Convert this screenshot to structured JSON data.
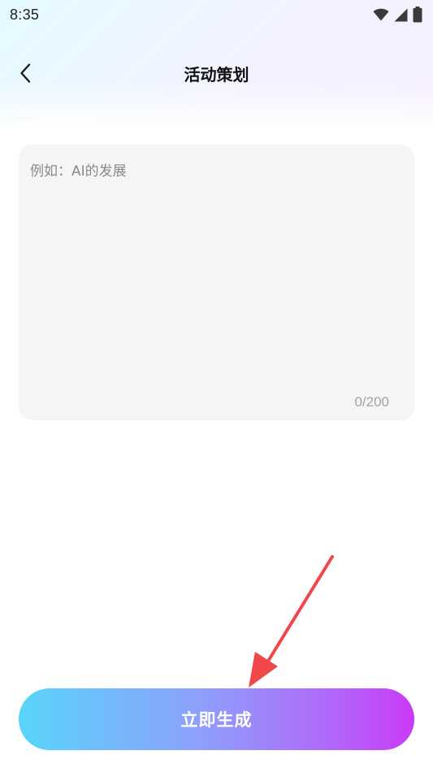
{
  "status_bar": {
    "time": "8:35",
    "icons": [
      "wifi-icon",
      "cellular-signal-icon",
      "battery-icon"
    ]
  },
  "nav": {
    "back_icon": "chevron-left-icon",
    "title": "活动策划"
  },
  "input": {
    "value": "",
    "placeholder": "例如：AI的发展",
    "counter": "0/200"
  },
  "generate_button": {
    "label": "立即生成"
  },
  "annotation": {
    "arrow_color": "#f0474b"
  },
  "colors": {
    "button_gradient_start": "#58d5fb",
    "button_gradient_end": "#c93af7",
    "input_background": "#f5f5f5"
  }
}
